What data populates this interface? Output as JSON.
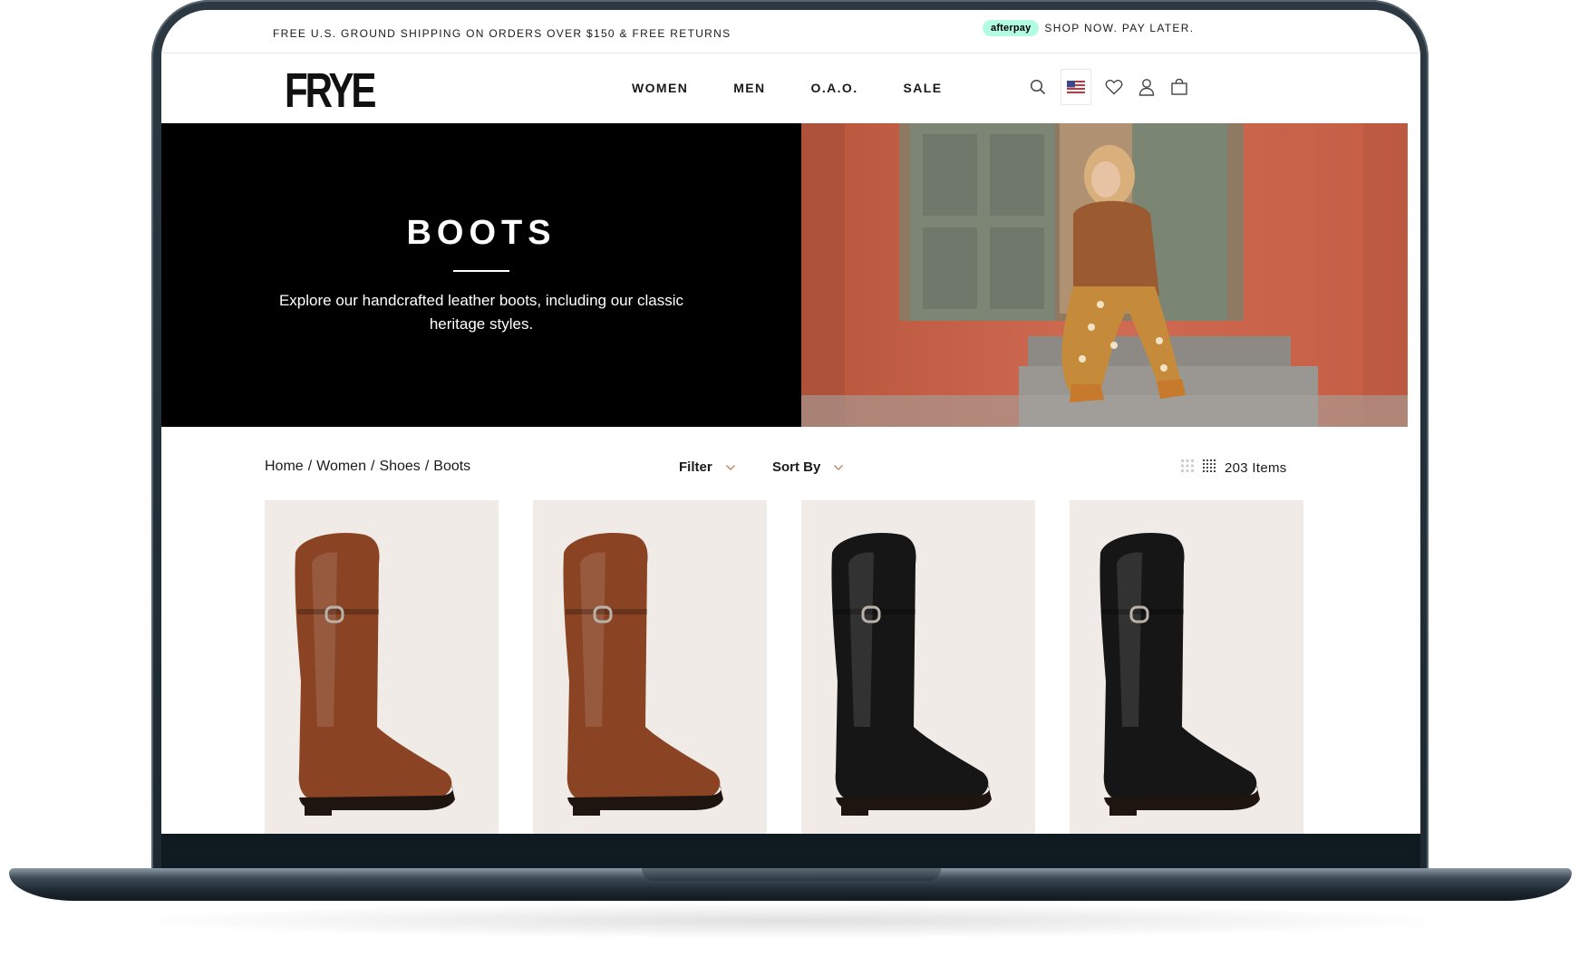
{
  "announcement": {
    "left_text": "FREE U.S. GROUND SHIPPING ON ORDERS OVER $150 & FREE RETURNS",
    "afterpay_logo": "afterpay",
    "right_text": "SHOP NOW. PAY LATER."
  },
  "header": {
    "logo": "FRYE",
    "nav": [
      "WOMEN",
      "MEN",
      "O.A.O.",
      "SALE"
    ],
    "icons": [
      "search-icon",
      "us-flag-icon",
      "heart-icon",
      "user-icon",
      "bag-icon"
    ]
  },
  "hero": {
    "title": "BOOTS",
    "description": "Explore our handcrafted leather boots, including our classic heritage styles."
  },
  "toolbar": {
    "breadcrumb": [
      "Home",
      "Women",
      "Shoes",
      "Boots"
    ],
    "separator": "/",
    "filter_label": "Filter",
    "sort_label": "Sort By",
    "items_count": "203 Items"
  },
  "products": [
    {
      "color_name": "brown",
      "color": "#8a4424"
    },
    {
      "color_name": "brown",
      "color": "#8a4424"
    },
    {
      "color_name": "black",
      "color": "#161616"
    },
    {
      "color_name": "black",
      "color": "#161616"
    }
  ],
  "colors": {
    "afterpay": "#b2fce4",
    "hero_bg": "#000000",
    "card_bg": "#f0ebe6",
    "chevron": "#c08a6a"
  }
}
